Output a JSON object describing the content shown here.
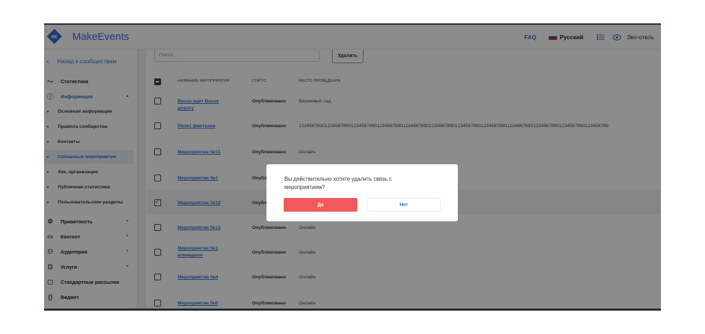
{
  "header": {
    "logo_text": "ME",
    "brand": "MakeEvents",
    "faq": "FAQ",
    "language": "Русский",
    "profile": "Эко-отель",
    "list_icon": "list-icon",
    "eye_icon": "eye-icon"
  },
  "sidebar": {
    "back": "Назад к сообществам",
    "items": [
      {
        "label": "Статистика",
        "icon": "chart-icon"
      },
      {
        "label": "Информация",
        "icon": "info-icon"
      },
      {
        "label": "Основная информация"
      },
      {
        "label": "Правила сообщества"
      },
      {
        "label": "Контакты"
      },
      {
        "label": "Связанные мероприятия"
      },
      {
        "label": "Акк. организации"
      },
      {
        "label": "Публичная статистика"
      },
      {
        "label": "Пользовательские разделы"
      },
      {
        "label": "Приватность",
        "icon": "gear-icon"
      },
      {
        "label": "Контент",
        "icon": "folder-icon"
      },
      {
        "label": "Аудитория",
        "icon": "audience-icon"
      },
      {
        "label": "Услуги",
        "icon": "bag-icon"
      },
      {
        "label": "Стандартные рассылки",
        "icon": "message-icon"
      },
      {
        "label": "Виджет",
        "icon": "code-icon"
      }
    ]
  },
  "toolbar": {
    "search_placeholder": "Поиск...",
    "delete_label": "Удалить"
  },
  "table": {
    "columns": [
      "НАЗВАНИЕ МЕРОПРИЯТИЯ",
      "СТАТУС",
      "МЕСТО ПРОВЕДЕНИЯ"
    ],
    "rows": [
      {
        "name": "Весна идет Весне дорогу",
        "status": "Опубликовано",
        "place": "Вишневый сад",
        "checked": false
      },
      {
        "name": "Полет фантазии",
        "status": "Опубликовано",
        "place": "12345678901234567890123456789012345678901234567890123456789012345678901234567890123456789012345678901234567890123456789",
        "checked": false
      },
      {
        "name": "Мероприятие №11",
        "status": "Опубликовано",
        "place": "Онлайн",
        "checked": false
      },
      {
        "name": "Мероприятие №1",
        "status": "Опубликовано",
        "place": "",
        "checked": false
      },
      {
        "name": "Мероприятие №12",
        "status": "Опубликовано",
        "place": "",
        "checked": true
      },
      {
        "name": "Мероприятие №13",
        "status": "Опубликовано",
        "place": "Онлайн",
        "checked": false
      },
      {
        "name": "Мероприятие №3 командное",
        "status": "Опубликовано",
        "place": "Онлайн",
        "checked": false
      },
      {
        "name": "Мероприятие №4",
        "status": "Опубликовано",
        "place": "Онлайн",
        "checked": false
      },
      {
        "name": "Мероприятие №6",
        "status": "Опубликовано",
        "place": "Онлайн",
        "checked": false
      }
    ]
  },
  "dialog": {
    "message": "Вы действительно хотите удалить связь с мероприятием?",
    "yes": "Да",
    "no": "Нет"
  },
  "colors": {
    "accent": "#2f6fd0",
    "danger": "#f05a5a"
  }
}
